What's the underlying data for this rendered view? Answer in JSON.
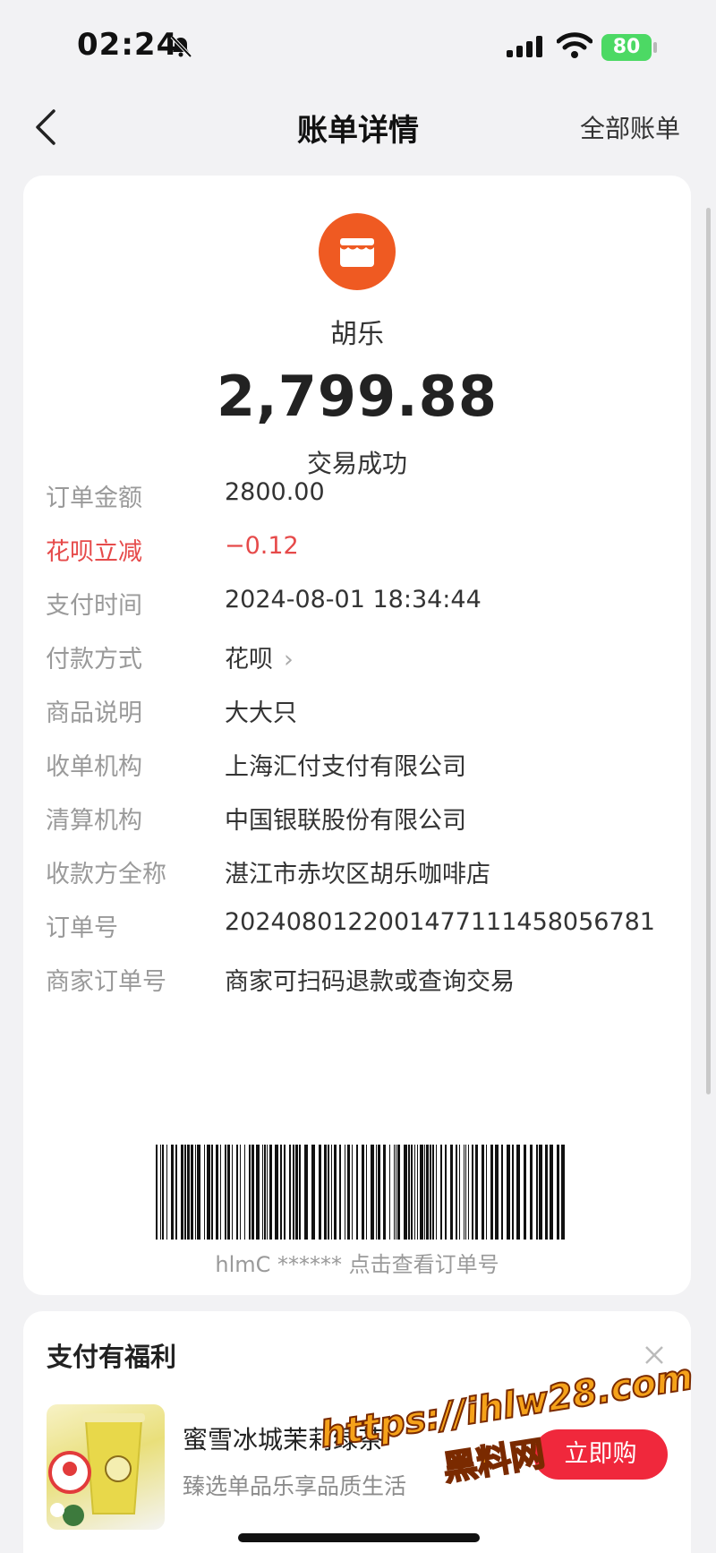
{
  "status_bar": {
    "time": "02:24",
    "battery": "80"
  },
  "nav": {
    "title": "账单详情",
    "all_bills": "全部账单"
  },
  "merchant": {
    "name": "胡乐",
    "amount": "2,799.88",
    "status": "交易成功"
  },
  "details": [
    {
      "label": "订单金额",
      "value": "2800.00"
    },
    {
      "label": "花呗立减",
      "value": "−0.12"
    },
    {
      "label": "支付时间",
      "value": "2024-08-01 18:34:44"
    },
    {
      "label": "付款方式",
      "value": "花呗"
    },
    {
      "label": "商品说明",
      "value": "大大只"
    },
    {
      "label": "收单机构",
      "value": "上海汇付支付有限公司"
    },
    {
      "label": "清算机构",
      "value": "中国银联股份有限公司"
    },
    {
      "label": "收款方全称",
      "value": "湛江市赤坎区胡乐咖啡店"
    },
    {
      "label": "订单号",
      "value": "2024080122001477111458056781"
    },
    {
      "label": "商家订单号",
      "value": "商家可扫码退款或查询交易"
    }
  ],
  "barcode": {
    "caption": "hlmC ****** 点击查看订单号"
  },
  "benefit": {
    "title": "支付有福利",
    "product_name": "蜜雪冰城茉莉绿茶",
    "product_desc": "臻选单品乐享品质生活",
    "buy_label": "立即购"
  },
  "watermark": {
    "url": "https://ihlw28.com",
    "name": "黑料网"
  },
  "colors": {
    "accent_red": "#e64a4a",
    "buy_button": "#f0283c",
    "merchant_logo": "#ef5a22",
    "battery": "#4cd964"
  }
}
